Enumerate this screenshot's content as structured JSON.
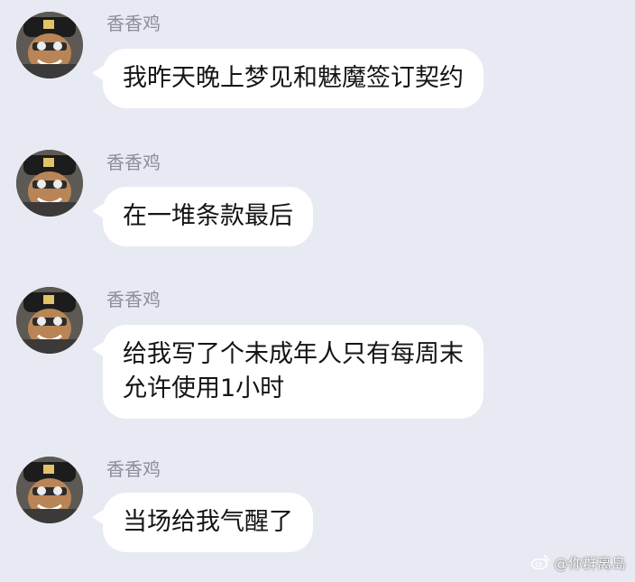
{
  "messages": [
    {
      "sender": "香香鸡",
      "text": "我昨天晚上梦见和魅魔签订契约"
    },
    {
      "sender": "香香鸡",
      "text": "在一堆条款最后"
    },
    {
      "sender": "香香鸡",
      "text": "给我写了个未成年人只有每周末\n允许使用1小时"
    },
    {
      "sender": "香香鸡",
      "text": "当场给我气醒了"
    }
  ],
  "watermark": {
    "icon": "weibo-logo-icon",
    "text": "@你群离岛"
  },
  "colors": {
    "background": "#e8eaf3",
    "bubble": "#ffffff",
    "sender_name": "#8b8e98",
    "message_text": "#141414"
  }
}
